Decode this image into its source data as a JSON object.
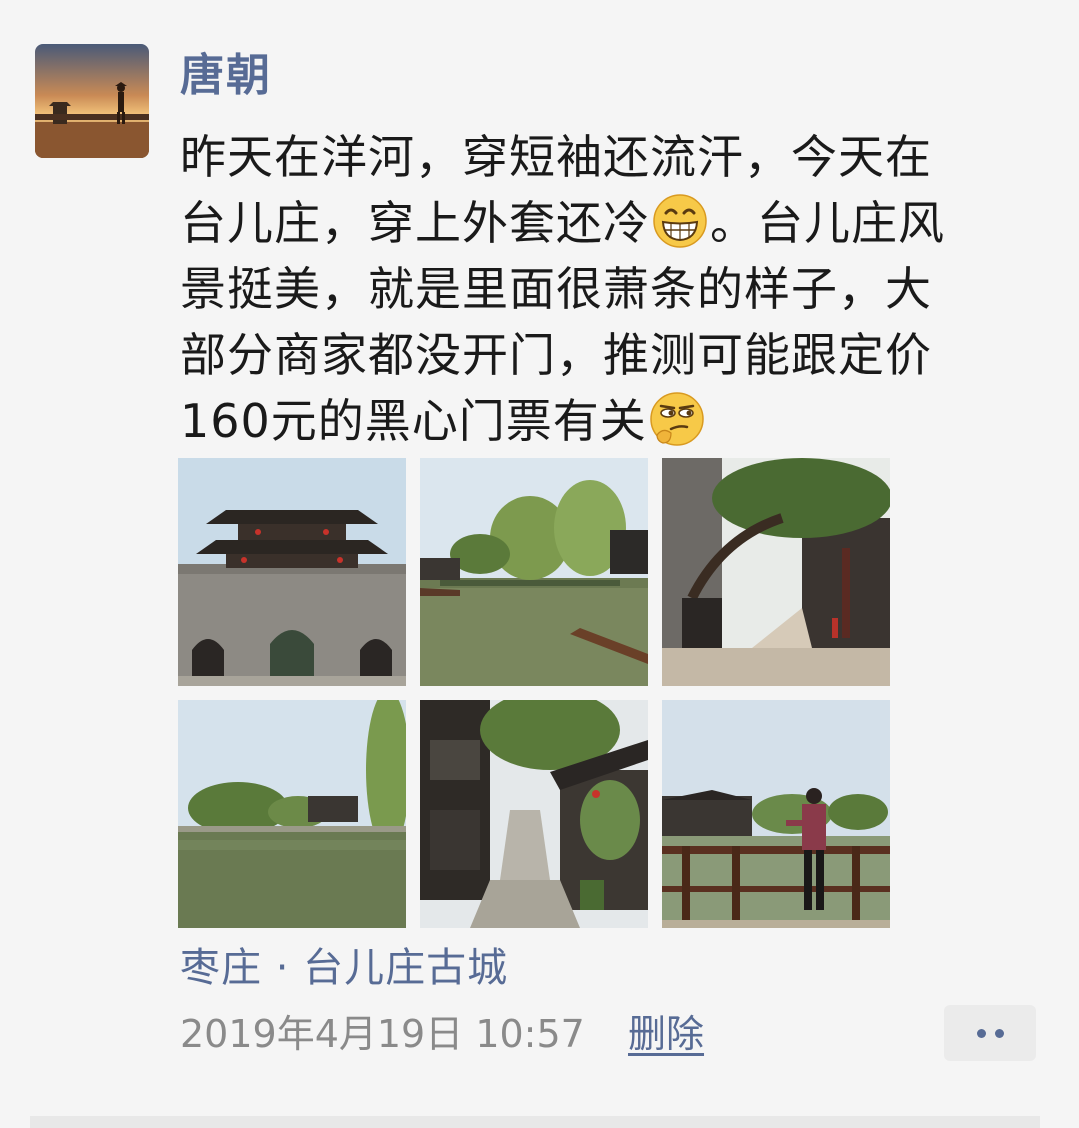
{
  "post": {
    "author": "唐朝",
    "text_line1": "昨天在洋河，穿短袖还流汗，今天在",
    "text_line2a": "台儿庄，穿上外套还冷",
    "text_line2b": "。台儿庄风",
    "text_line3": "景挺美，就是里面很萧条的样子，大",
    "text_line4": "部分商家都没开门，推测可能跟定价",
    "text_line5": "160元的黑心门票有关",
    "emoji_1": "grinning-face-icon",
    "emoji_2": "smirking-face-icon",
    "photos": [
      "city-gate-tower-photo",
      "canal-with-willows-photo",
      "old-street-with-tree-photo",
      "lake-with-willows-photo",
      "stone-alley-with-buildings-photo",
      "woman-by-railing-photo"
    ],
    "location": "枣庄 · 台儿庄古城",
    "timestamp": "2019年4月19日 10:57",
    "delete_label": "删除"
  },
  "colors": {
    "link": "#576b95",
    "text": "#1a1a1a",
    "meta": "#8a8a8a",
    "background": "#f5f5f5"
  }
}
